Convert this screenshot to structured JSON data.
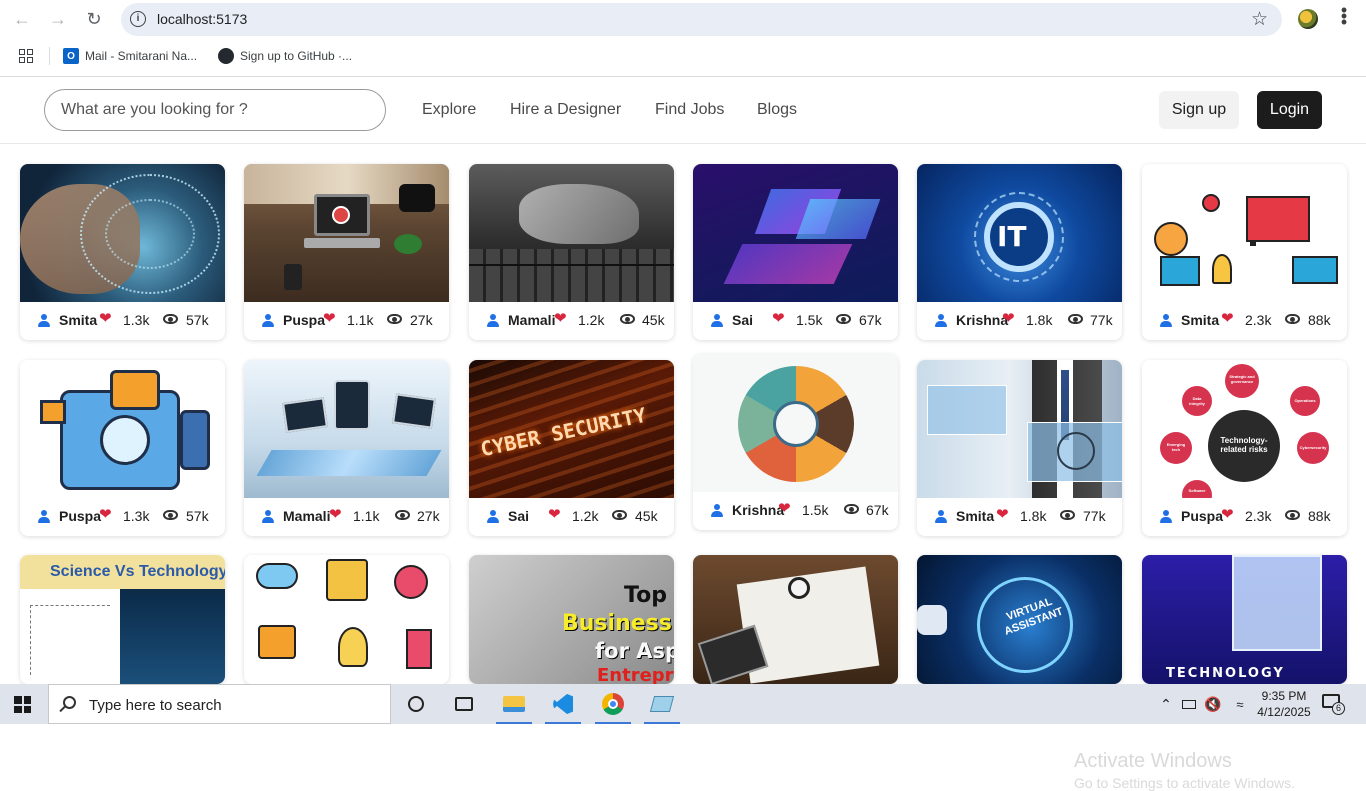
{
  "browser": {
    "url": "localhost:5173",
    "bookmarks": [
      {
        "label": "Mail - Smitarani Na..."
      },
      {
        "label": "Sign up to GitHub ·..."
      }
    ]
  },
  "site": {
    "search_placeholder": "What are you looking for ?",
    "nav": [
      "Explore",
      "Hire a Designer",
      "Find Jobs",
      "Blogs"
    ],
    "signup_label": "Sign up",
    "login_label": "Login"
  },
  "cards": [
    {
      "user": "Smita",
      "likes": "1.3k",
      "views": "57k"
    },
    {
      "user": "Puspa",
      "likes": "1.1k",
      "views": "27k"
    },
    {
      "user": "Mamali",
      "likes": "1.2k",
      "views": "45k"
    },
    {
      "user": "Sai",
      "likes": "1.5k",
      "views": "67k"
    },
    {
      "user": "Krishna",
      "likes": "1.8k",
      "views": "77k"
    },
    {
      "user": "Smita",
      "likes": "2.3k",
      "views": "88k"
    },
    {
      "user": "Puspa",
      "likes": "1.3k",
      "views": "57k"
    },
    {
      "user": "Mamali",
      "likes": "1.1k",
      "views": "27k"
    },
    {
      "user": "Sai",
      "likes": "1.2k",
      "views": "45k"
    },
    {
      "user": "Krishna",
      "likes": "1.5k",
      "views": "67k"
    },
    {
      "user": "Smita",
      "likes": "1.8k",
      "views": "77k"
    },
    {
      "user": "Puspa",
      "likes": "2.3k",
      "views": "88k"
    }
  ],
  "thumb_text": {
    "it": "IT",
    "risks_center": "Technology-\nrelated risks",
    "risk_nodes": [
      "Strategic and\ngovernance",
      "Operations",
      "Cybersecurity",
      "Emerging\ntech",
      "Data\nintegrity",
      "Software"
    ],
    "cyber": "CYBER SECURITY",
    "science_vs_tech": "Science Vs Technology",
    "top": "Top",
    "business": "Business Id",
    "for_asp": "for Aspi",
    "entrepren": "Entrepren",
    "virtual": "VIRTUAL\nASSISTANT",
    "technology": "TECHNOLOGY"
  },
  "watermark": {
    "line1": "Activate Windows",
    "line2": "Go to Settings to activate Windows."
  },
  "taskbar": {
    "search_text": "Type here to search",
    "time": "9:35 PM",
    "date": "4/12/2025",
    "notification_count": "6"
  }
}
